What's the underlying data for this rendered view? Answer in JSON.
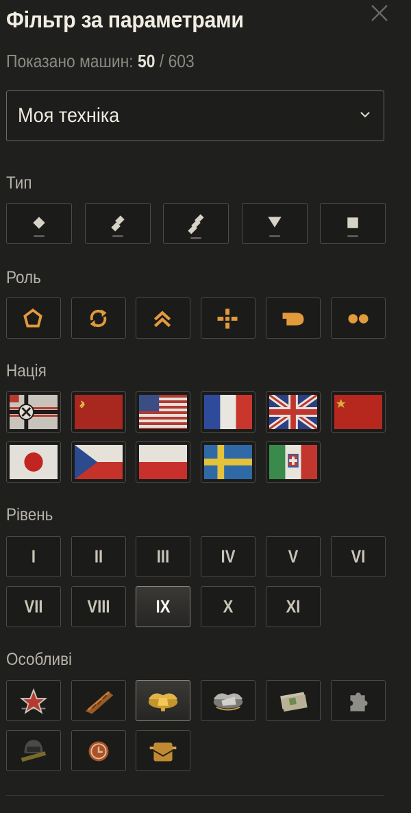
{
  "header": {
    "title": "Фільтр за параметрами",
    "count_label": "Показано машин:",
    "count_shown": "50",
    "count_sep": "/",
    "count_total": "603"
  },
  "dropdown": {
    "value": "Моя техніка"
  },
  "sections": {
    "type": "Тип",
    "role": "Роль",
    "nation": "Нація",
    "level": "Рівень",
    "special": "Особливі"
  },
  "types": [
    {
      "icon": "light-tank-icon"
    },
    {
      "icon": "medium-tank-icon"
    },
    {
      "icon": "heavy-tank-icon"
    },
    {
      "icon": "tank-destroyer-icon"
    },
    {
      "icon": "spg-icon"
    }
  ],
  "roles": [
    {
      "icon": "pentagon-role-icon"
    },
    {
      "icon": "circle-arrows-role-icon"
    },
    {
      "icon": "double-chevron-role-icon"
    },
    {
      "icon": "crosshair-role-icon"
    },
    {
      "icon": "bullet-role-icon"
    },
    {
      "icon": "two-dots-role-icon"
    }
  ],
  "nations": [
    {
      "icon": "germany-flag-icon"
    },
    {
      "icon": "ussr-flag-icon"
    },
    {
      "icon": "usa-flag-icon"
    },
    {
      "icon": "france-flag-icon"
    },
    {
      "icon": "uk-flag-icon"
    },
    {
      "icon": "china-flag-icon"
    },
    {
      "icon": "japan-flag-icon"
    },
    {
      "icon": "czech-flag-icon"
    },
    {
      "icon": "poland-flag-icon"
    },
    {
      "icon": "sweden-flag-icon"
    },
    {
      "icon": "italy-flag-icon"
    }
  ],
  "levels": [
    {
      "label": "I"
    },
    {
      "label": "II"
    },
    {
      "label": "III"
    },
    {
      "label": "IV"
    },
    {
      "label": "V"
    },
    {
      "label": "VI"
    },
    {
      "label": "VII"
    },
    {
      "label": "VIII"
    },
    {
      "label": "IX",
      "selected": true
    },
    {
      "label": "X"
    },
    {
      "label": "XI"
    }
  ],
  "specials": [
    {
      "icon": "star-emblem-icon"
    },
    {
      "icon": "shell-camo-icon"
    },
    {
      "icon": "golden-wings-icon"
    },
    {
      "icon": "silver-wings-icon"
    },
    {
      "icon": "cash-bundle-icon"
    },
    {
      "icon": "puzzle-piece-icon"
    },
    {
      "icon": "crew-helmet-icon"
    },
    {
      "icon": "clock-rental-icon"
    },
    {
      "icon": "gold-badge-icon"
    }
  ],
  "colors": {
    "accent": "#e29a3a",
    "border": "#4e4c46",
    "bg": "#1f1f1e"
  }
}
